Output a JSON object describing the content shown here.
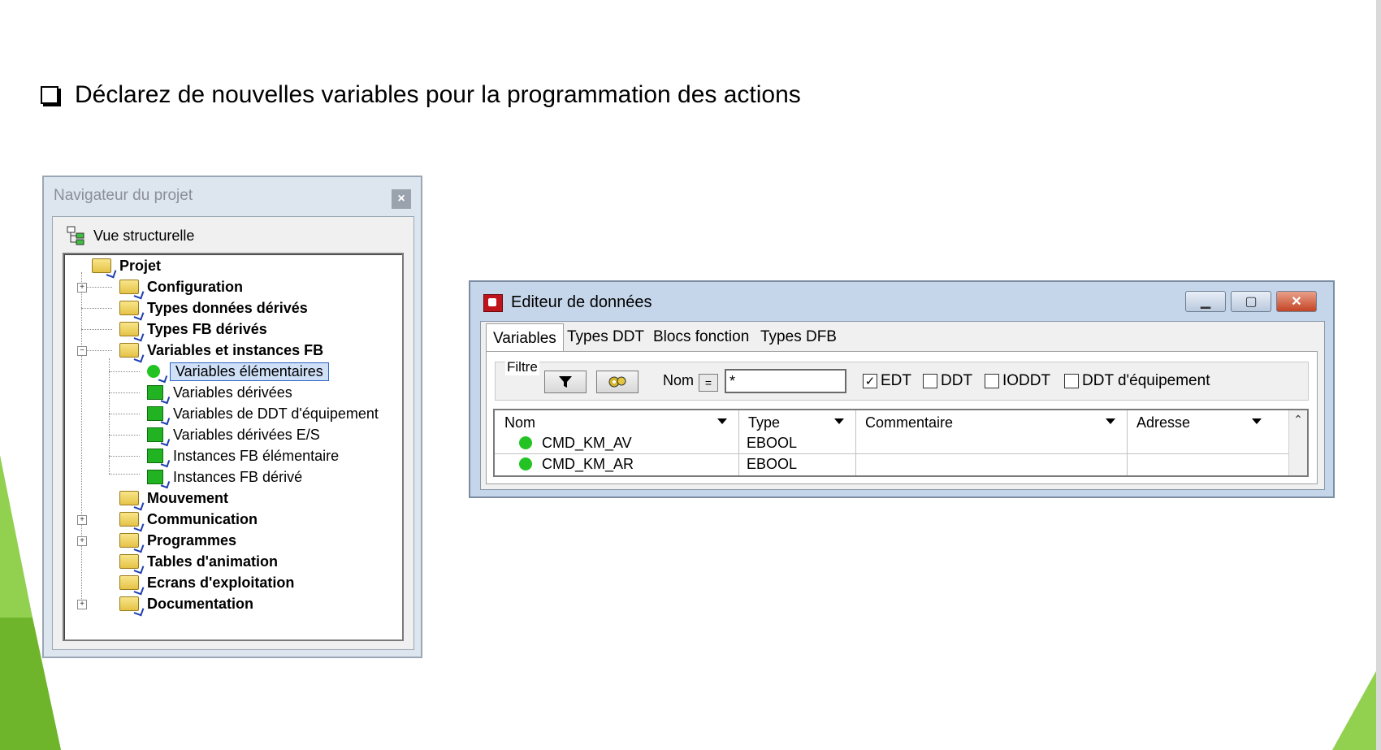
{
  "slide": {
    "heading": "Déclarez de nouvelles variables pour la programmation des actions"
  },
  "navigator": {
    "title": "Navigateur du projet",
    "close_glyph": "×",
    "view_label": "Vue structurelle",
    "tree": {
      "root": "Projet",
      "configuration": "Configuration",
      "types_donnees": "Types données dérivés",
      "types_fb": "Types FB dérivés",
      "variables_fb": "Variables et instances FB",
      "var_elem": "Variables élémentaires",
      "var_derivees": "Variables dérivées",
      "var_ddt_equip": "Variables de DDT d'équipement",
      "var_derivees_es": "Variables dérivées E/S",
      "inst_fb_elem": "Instances FB élémentaire",
      "inst_fb_derive": "Instances FB dérivé",
      "mouvement": "Mouvement",
      "communication": "Communication",
      "programmes": "Programmes",
      "tables_animation": "Tables d'animation",
      "ecrans": "Ecrans d'exploitation",
      "documentation": "Documentation"
    }
  },
  "editor": {
    "title": "Editeur de données",
    "tabs": [
      "Variables",
      "Types DDT",
      "Blocs fonction",
      "Types DFB"
    ],
    "filter_label": "Filtre",
    "name_label": "Nom",
    "eq_label": "=",
    "name_value": "*",
    "checkboxes": [
      {
        "label": "EDT",
        "checked": true
      },
      {
        "label": "DDT",
        "checked": false
      },
      {
        "label": "IODDT",
        "checked": false
      },
      {
        "label": "DDT d'équipement",
        "checked": false
      }
    ],
    "columns": [
      "Nom",
      "Type",
      "Commentaire",
      "Adresse"
    ],
    "rows": [
      {
        "name": "CMD_KM_AV",
        "type": "EBOOL",
        "comment": "",
        "address": ""
      },
      {
        "name": "CMD_KM_AR",
        "type": "EBOOL",
        "comment": "",
        "address": ""
      }
    ],
    "check_glyph": "✓"
  },
  "colors": {
    "slide_green": "#92d050",
    "selection": "#cfe0f7",
    "variable_green": "#22c322"
  }
}
